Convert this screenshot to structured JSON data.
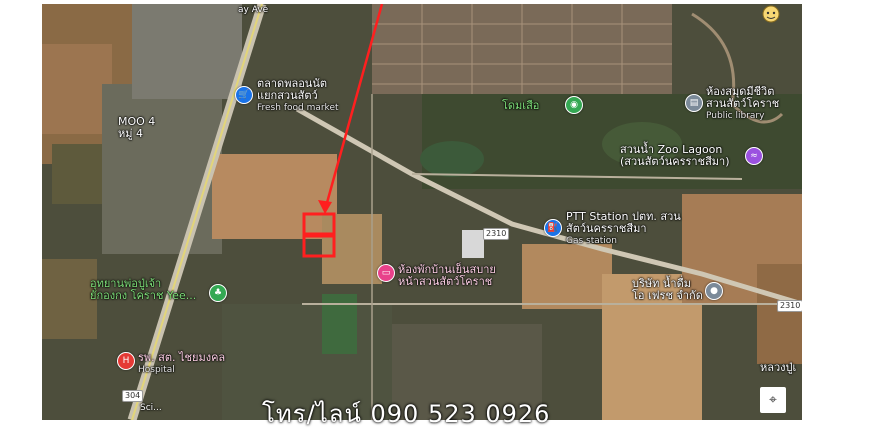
{
  "map": {
    "labels": {
      "market_th": "ตลาดพลอนนัต",
      "market_th2": "แยกสวนสัตว์",
      "market_en": "Fresh food market",
      "moo_en": "MOO 4",
      "moo_th": "หมู่ 4",
      "tiger_th": "โดมเสือ",
      "library_th": "ห้องสมุดมีชีวิต",
      "library_th2": "สวนสัตว์โคราช",
      "library_en": "Public library",
      "zoo_lagoon": "สวนน้ำ Zoo Lagoon",
      "zoo_lagoon2": "(สวนสัตว์นครราชสีมา)",
      "ptt": "PTT Station ปตท. สวน",
      "ptt2": "สัตว์นครราชสีมา",
      "ptt_en": "Gas station",
      "hotel": "ห้องพักบ้านเย็นสบาย",
      "hotel2": "หน้าสวนสัตว์โคราช",
      "park": "อุทยานพ่อปู่เจ้า",
      "park2": "ยักองกง โคราช Yee...",
      "company": "บริษัท น้ำดื่ม",
      "company2": "โอ เฟรช จำกัด",
      "hospital": "รพ. สต. ไชยมงคล",
      "hospital_en": "Hospital",
      "east_edge": "หลวงปู่เ",
      "road_top": "ay Ave",
      "road_2310_a": "2310",
      "road_2310_b": "2310",
      "road_304": "304",
      "road_sci": "Sci..."
    },
    "icons": {
      "market": "shopping-cart-icon",
      "tiger": "paw-icon",
      "library": "book-icon",
      "zoo": "water-park-icon",
      "ptt": "gas-station-icon",
      "hotel": "hotel-bed-icon",
      "park": "tree-icon",
      "company": "location-pin-icon",
      "hospital": "hospital-icon"
    },
    "colors": {
      "highlight": "#ff1f1f",
      "market_pin": "#1a73e8",
      "poi_green": "#34a853",
      "poi_gray": "#7b8a99",
      "zoo_purple": "#9b51e0",
      "hotel_pink": "#e8418a",
      "hospital_red": "#e53935"
    }
  },
  "overlay": {
    "phone": "โทร/ไลน์ 090 523 0926"
  }
}
